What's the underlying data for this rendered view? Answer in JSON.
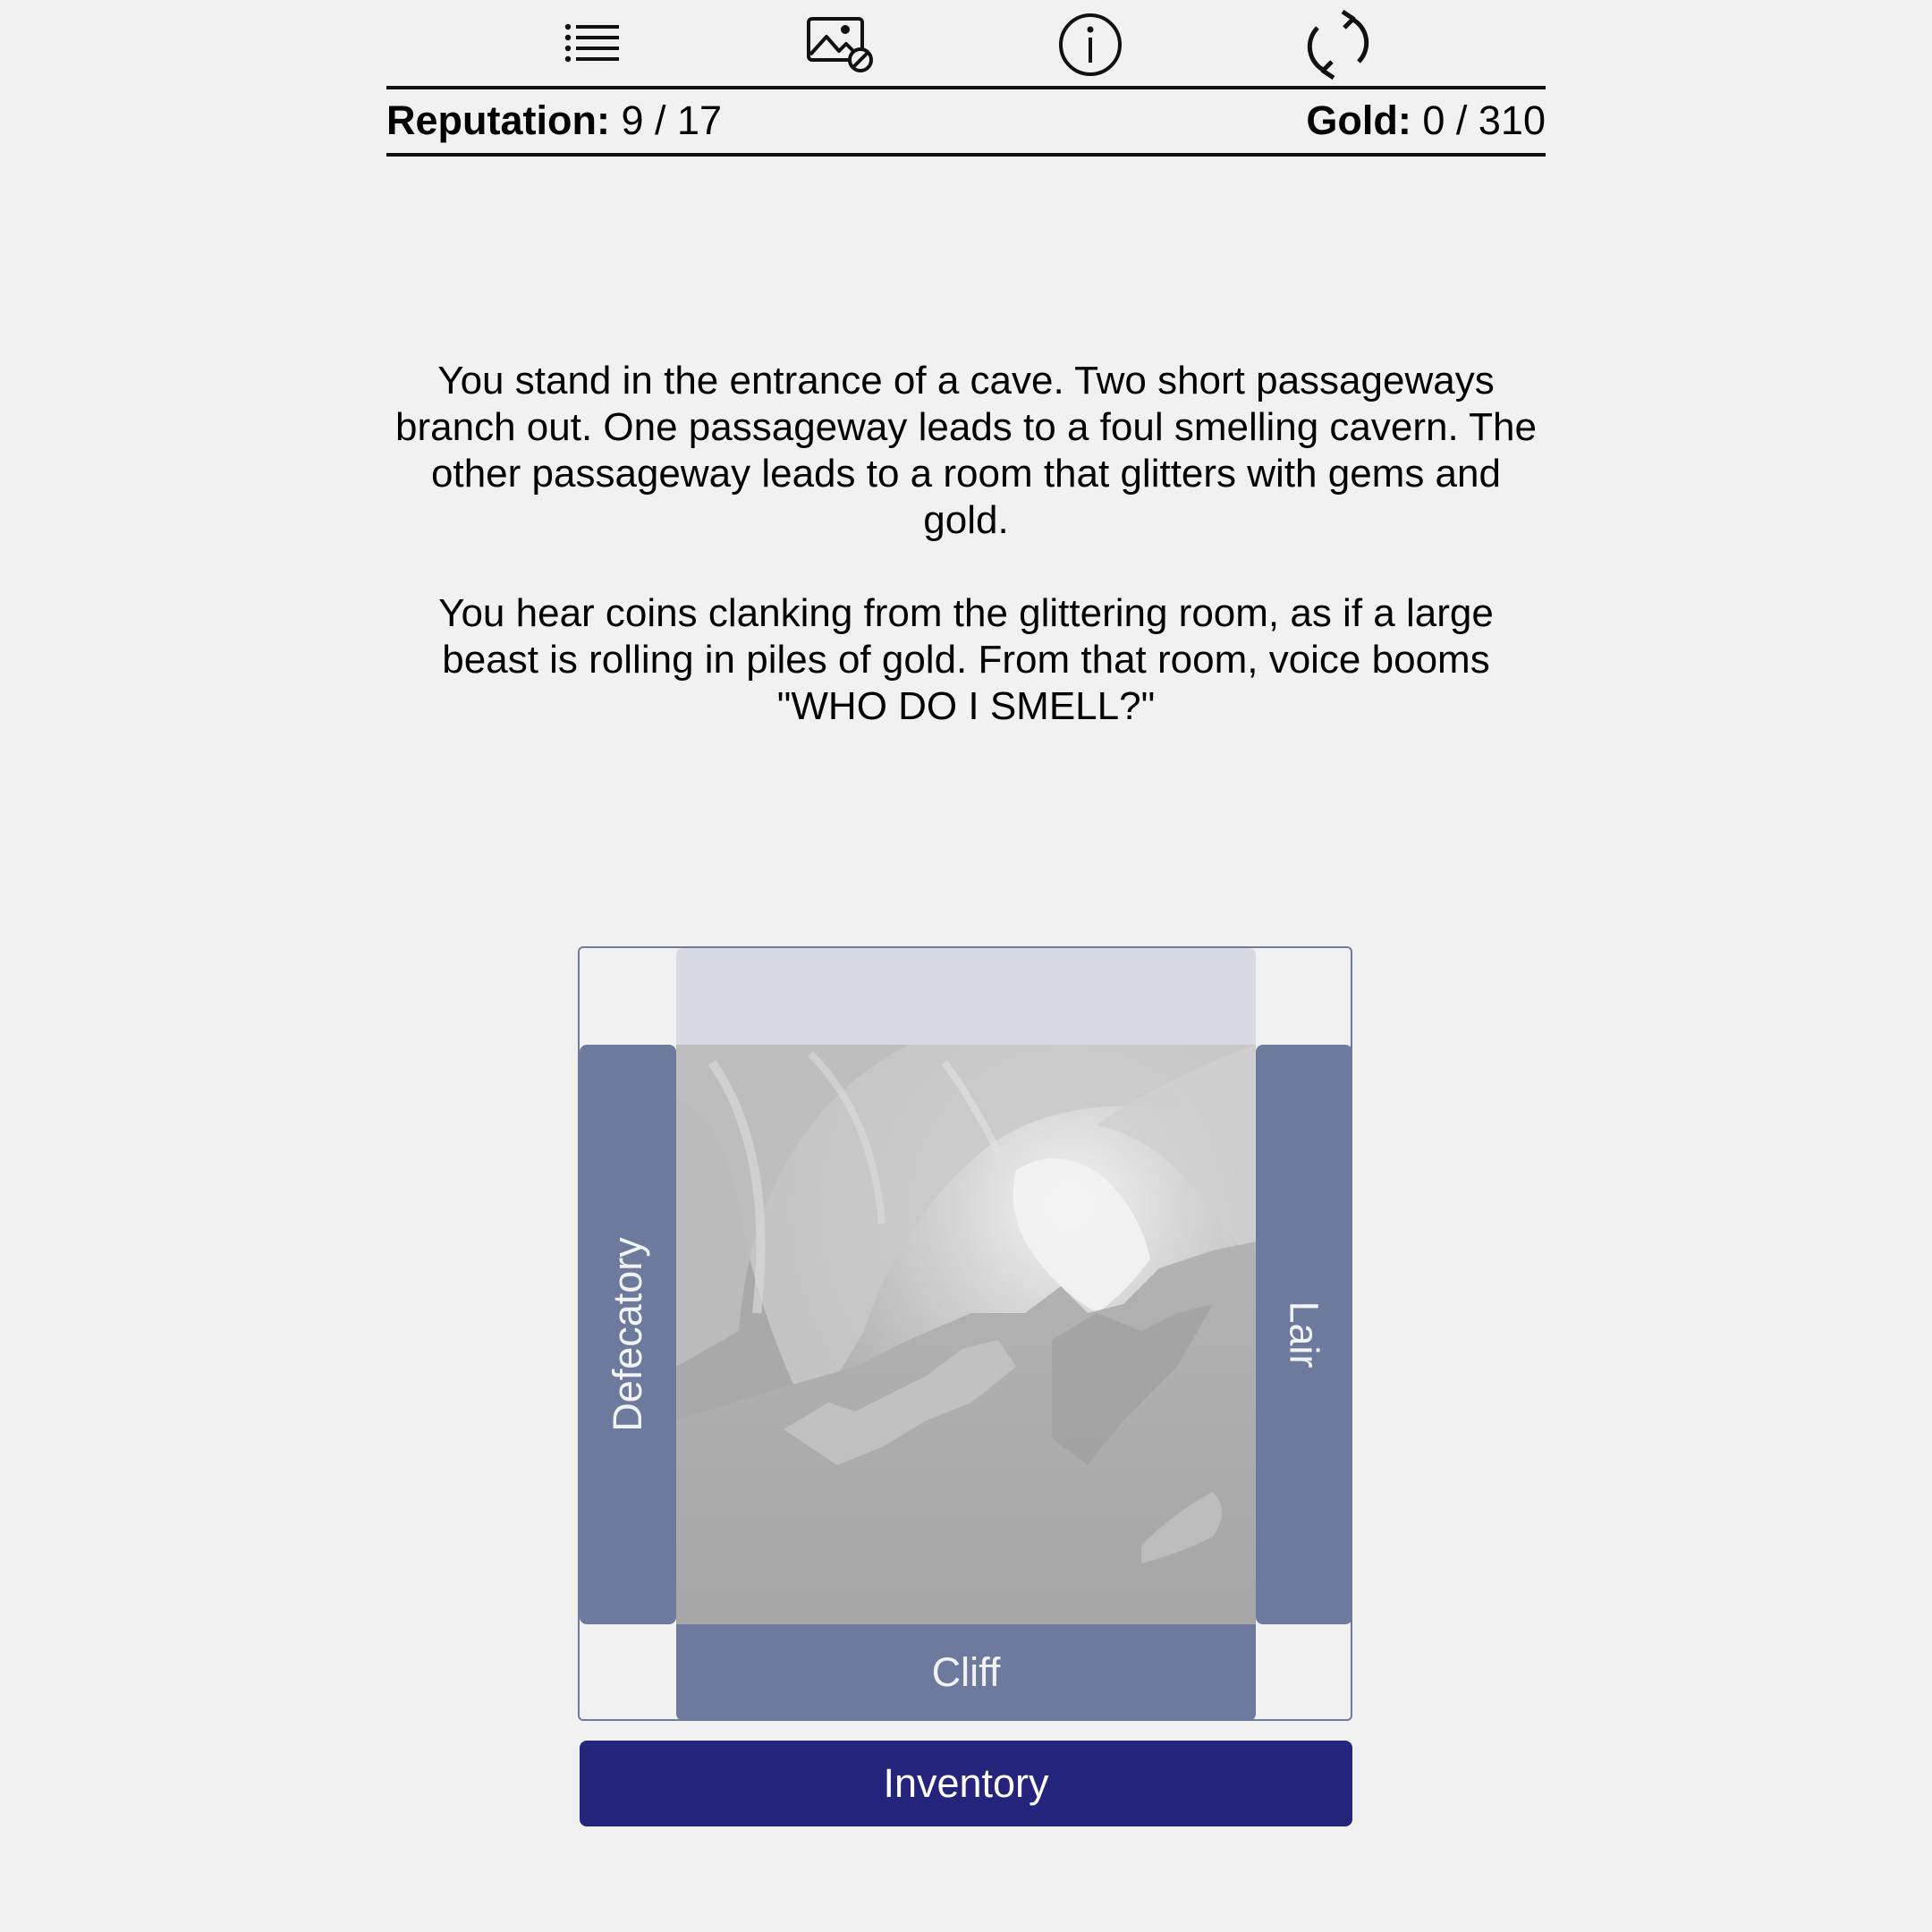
{
  "toolbar": {
    "icons": [
      "list-icon",
      "image-off-icon",
      "info-icon",
      "restart-icon"
    ]
  },
  "stats": {
    "reputation_label": "Reputation:",
    "reputation_value": "9 / 17",
    "gold_label": "Gold:",
    "gold_value": "0 / 310"
  },
  "narrative": {
    "paragraphs": [
      "You stand in the entrance of a cave. Two short passageways branch out. One passageway leads to a foul smelling cavern. The other passageway leads to a room that glitters with gems and gold.",
      "You hear coins clanking from the glittering room, as if a large beast is rolling in piles of gold. From that room, voice booms \"WHO DO I SMELL?\""
    ]
  },
  "navigation": {
    "west_label": "Defecatory",
    "east_label": "Lair",
    "south_label": "Cliff"
  },
  "inventory": {
    "label": "Inventory"
  },
  "colors": {
    "background": "#f1f1f1",
    "nav_button": "#6d7a9d",
    "nav_disabled": "#d7d9e3",
    "inventory_button": "#25247c",
    "scene_gray": "#a9a9a9"
  }
}
